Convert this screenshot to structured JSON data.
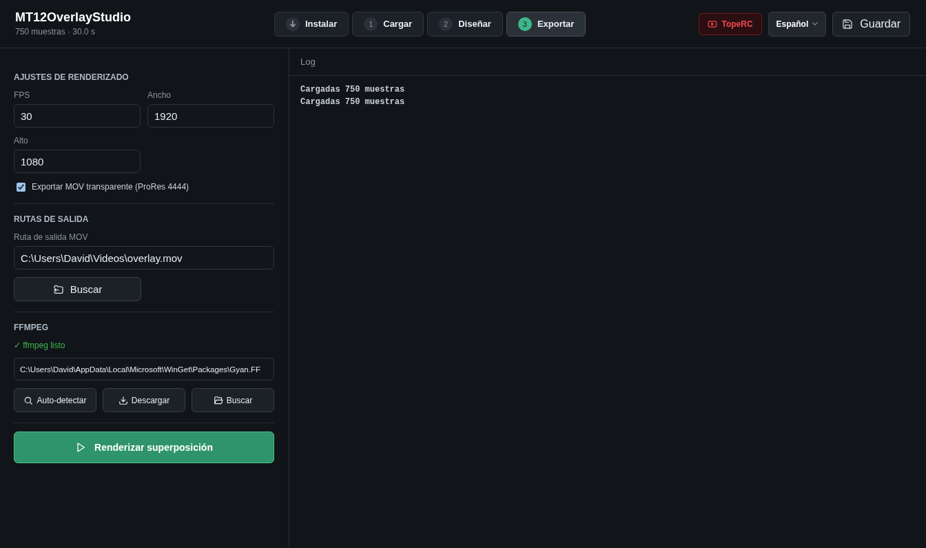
{
  "app": {
    "title": "MT12OverlayStudio",
    "subtitle": "750 muestras · 30.0 s"
  },
  "steps": [
    {
      "kind": "install",
      "label": "Instalar",
      "selected": false
    },
    {
      "kind": "number",
      "number": "1",
      "label": "Cargar",
      "selected": false
    },
    {
      "kind": "number",
      "number": "2",
      "label": "Diseñar",
      "selected": false
    },
    {
      "kind": "number",
      "number": "3",
      "label": "Exportar",
      "selected": true
    }
  ],
  "channel_button": {
    "label": "TopeRC"
  },
  "language": {
    "value": "Español"
  },
  "save_button": {
    "label": "Guardar"
  },
  "render_settings": {
    "title": "AJUSTES DE RENDERIZADO",
    "fields": [
      {
        "label": "FPS",
        "value": "30"
      },
      {
        "label": "Ancho",
        "value": "1920"
      },
      {
        "label": "Alto",
        "value": "1080"
      }
    ],
    "transparent_mov": {
      "label": "Exportar MOV transparente (ProRes 4444)",
      "checked": true
    }
  },
  "output_paths": {
    "title": "RUTAS DE SALIDA",
    "field": {
      "label": "Ruta de salida MOV",
      "value": "C:\\Users\\David\\Videos\\overlay.mov"
    },
    "browse_button": {
      "label": "Buscar"
    }
  },
  "ffmpeg": {
    "title": "FFMPEG",
    "status": {
      "text": "✓ ffmpeg listo",
      "ok": true
    },
    "path": {
      "value": "C:\\Users\\David\\AppData\\Local\\Microsoft\\WinGet\\Packages\\Gyan.FF"
    },
    "buttons": [
      {
        "kind": "detect",
        "label": "Auto-detectar"
      },
      {
        "kind": "download",
        "label": "Descargar"
      },
      {
        "kind": "browse",
        "label": "Buscar"
      }
    ]
  },
  "render_button": {
    "label": "Renderizar superposición"
  },
  "log": {
    "title": "Log",
    "lines": [
      "Cargadas 750 muestras",
      "Cargadas 750 muestras"
    ]
  }
}
